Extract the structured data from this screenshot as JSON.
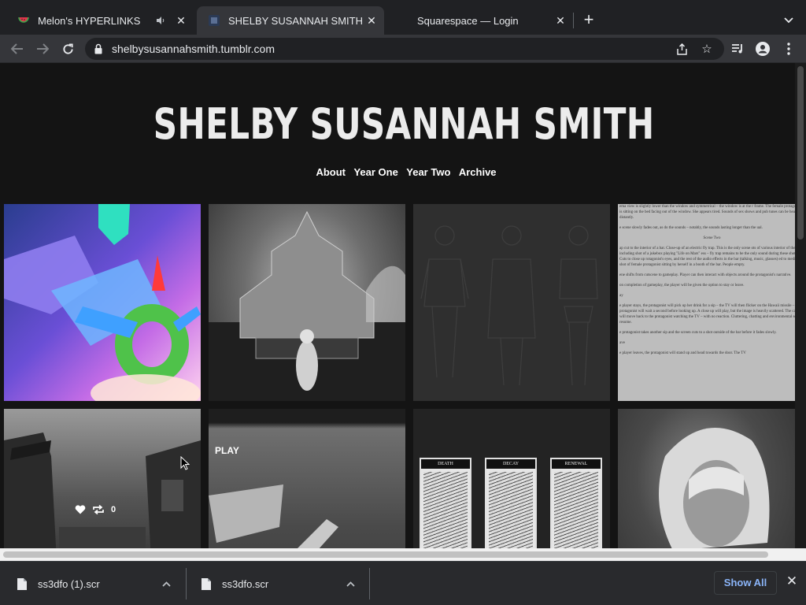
{
  "browser": {
    "tabs": [
      {
        "title": "Melon's HYPERLINKS",
        "icon": "watermelon-icon",
        "active": false,
        "audio": true
      },
      {
        "title": "SHELBY SUSANNAH SMITH",
        "icon": "tumblr-favicon-icon",
        "active": true,
        "audio": false
      },
      {
        "title": "Squarespace — Login",
        "icon": "squarespace-favicon-icon",
        "active": false,
        "audio": false
      }
    ],
    "url": "shelbysusannahsmith.tumblr.com"
  },
  "site": {
    "title": "SHELBY SUSANNAH SMITH",
    "nav": [
      "About",
      "Year One",
      "Year Two",
      "Archive"
    ]
  },
  "posts": [
    {
      "kind": "image",
      "desc": "colorful 3D render"
    },
    {
      "kind": "image",
      "desc": "inverted fountain photo"
    },
    {
      "kind": "image",
      "desc": "character outline sketches"
    },
    {
      "kind": "text"
    },
    {
      "kind": "image",
      "desc": "street photo",
      "notes": {
        "count": "0"
      }
    },
    {
      "kind": "video",
      "play_label": "PLAY"
    },
    {
      "kind": "image",
      "desc": "tarot cards",
      "cards": [
        "DEATH",
        "DECAY",
        "RENEWAL"
      ]
    },
    {
      "kind": "image",
      "desc": "portrait photo"
    }
  ],
  "document_text": {
    "p1": "ema view is slightly lower than the window and symmetrical – the window is at the r frame. The female protagonist is sitting on the bed facing out of the window. She appears tired. Sounds of sex shows and pub tunes can be heard distantly.",
    "p2": "e scene slowly fades out, as do the sounds – notably, the sounds lasting longer than the ual.",
    "heading": "Scene Two",
    "p3": "ap cut to the interior of a bar. Close-up of an electric fly trap. This is the only scene ots of various interior of the bar, including shot of a jukebox playing \"Life on Mars\" ess – fly trap remains to be the only sound during these shots. Cuts to close up rotagonist's eyes, and the rest of the audio effects in the bar (talking, music, glasses) ed to medium shot of female protagonist sitting by herself in a booth of the bar. People empty.",
    "p4": "ene shifts from cutscene to gameplay. Player can then interact with objects around the protagonist's narrative.",
    "p5": "on completion of gameplay, the player will be given the option to stay or leave.",
    "p6": "ay",
    "p7": "e player stays, the protagonist will pick up her drink for a sip – the TV will then flicker on the Hawaii missile – the protagonist will wait a second before looking up. A close up will play, but the image is heavily scattered. The camera will move back to the protagonist watching the TV – with no reaction. Cluttering, chatting and environmental sounds resume.",
    "p8": "e protagonist takes another sip and the screen cuts to a shot outside of the bar before it fades slowly.",
    "p9": "ave",
    "p10": "e player leaves, the protagonist will stand up and head towards the door. The TV"
  },
  "downloads": [
    {
      "filename": "ss3dfo (1).scr"
    },
    {
      "filename": "ss3dfo.scr"
    }
  ],
  "shelf": {
    "show_all": "Show All"
  },
  "colors": {
    "page_bg": "#141414",
    "chrome_bg": "#202124",
    "toolbar_bg": "#35363a",
    "link_blue": "#8ab4f8"
  }
}
